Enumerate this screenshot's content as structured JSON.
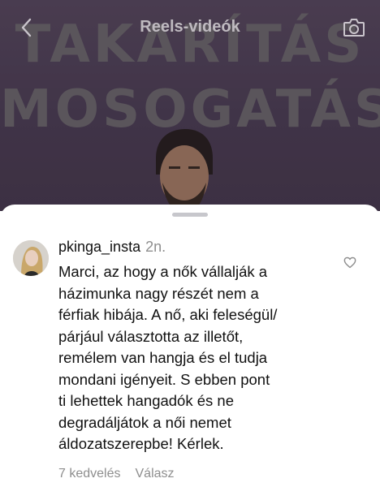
{
  "header": {
    "title": "Reels-videók",
    "back_icon": "chevron-left-icon",
    "camera_icon": "camera-icon"
  },
  "reel": {
    "overlay_line_1": "TAKARÍTÁS",
    "overlay_line_2": "MOSOGATÁS"
  },
  "comment": {
    "username": "pkinga_insta",
    "time": "2n.",
    "text_lines": [
      "Marci, az hogy a nők vállalják a",
      "házimunka nagy részét nem a",
      "férfiak hibája. A nő, aki feleségül/",
      "párjául választotta az illetőt,",
      "remélem van hangja és el tudja",
      "mondani igényeit. S ebben pont",
      "ti lehettek hangadók és ne",
      "degradáljátok a női nemet",
      "áldozatszerepbe! Kérlek."
    ],
    "likes_label": "7 kedvelés",
    "reply_label": "Válasz",
    "like_icon": "heart-outline-icon"
  },
  "colors": {
    "reel_background": "#4f4058",
    "text_primary": "#111111",
    "text_secondary": "#8e8e8e",
    "sheet_background": "#ffffff"
  }
}
